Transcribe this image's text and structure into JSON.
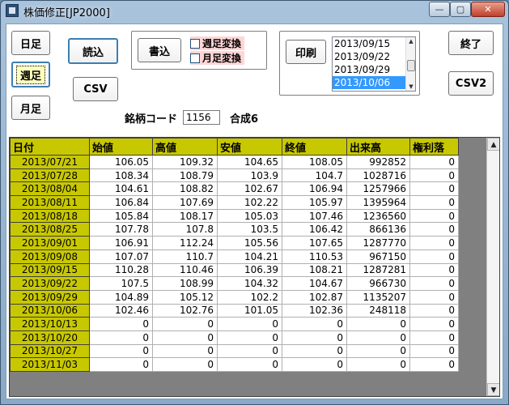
{
  "window": {
    "title": "株価修正[JP2000]",
    "min_glyph": "—",
    "max_glyph": "▢",
    "close_glyph": "✕"
  },
  "buttons": {
    "daily": "日足",
    "weekly": "週足",
    "monthly": "月足",
    "load": "読込",
    "csv": "CSV",
    "write": "書込",
    "print": "印刷",
    "exit": "終了",
    "csv2": "CSV2"
  },
  "checks": {
    "weekly_convert": "週足変換",
    "monthly_convert": "月足変換"
  },
  "date_list": [
    "2013/09/15",
    "2013/09/22",
    "2013/09/29",
    "2013/10/06"
  ],
  "date_list_selected": "2013/10/06",
  "stock": {
    "code_label": "銘柄コード",
    "code": "1156",
    "name": "合成6"
  },
  "grid": {
    "headers": [
      "日付",
      "始値",
      "高値",
      "安値",
      "終値",
      "出来高",
      "権利落"
    ],
    "rows": [
      [
        "2013/07/21",
        "106.05",
        "109.32",
        "104.65",
        "108.05",
        "992852",
        "0"
      ],
      [
        "2013/07/28",
        "108.34",
        "108.79",
        "103.9",
        "104.7",
        "1028716",
        "0"
      ],
      [
        "2013/08/04",
        "104.61",
        "108.82",
        "102.67",
        "106.94",
        "1257966",
        "0"
      ],
      [
        "2013/08/11",
        "106.84",
        "107.69",
        "102.22",
        "105.97",
        "1395964",
        "0"
      ],
      [
        "2013/08/18",
        "105.84",
        "108.17",
        "105.03",
        "107.46",
        "1236560",
        "0"
      ],
      [
        "2013/08/25",
        "107.78",
        "107.8",
        "103.5",
        "106.42",
        "866136",
        "0"
      ],
      [
        "2013/09/01",
        "106.91",
        "112.24",
        "105.56",
        "107.65",
        "1287770",
        "0"
      ],
      [
        "2013/09/08",
        "107.07",
        "110.7",
        "104.21",
        "110.53",
        "967150",
        "0"
      ],
      [
        "2013/09/15",
        "110.28",
        "110.46",
        "106.39",
        "108.21",
        "1287281",
        "0"
      ],
      [
        "2013/09/22",
        "107.5",
        "108.99",
        "104.32",
        "104.67",
        "966730",
        "0"
      ],
      [
        "2013/09/29",
        "104.89",
        "105.12",
        "102.2",
        "102.87",
        "1135207",
        "0"
      ],
      [
        "2013/10/06",
        "102.46",
        "102.76",
        "101.05",
        "102.36",
        "248118",
        "0"
      ],
      [
        "2013/10/13",
        "0",
        "0",
        "0",
        "0",
        "0",
        "0"
      ],
      [
        "2013/10/20",
        "0",
        "0",
        "0",
        "0",
        "0",
        "0"
      ],
      [
        "2013/10/27",
        "0",
        "0",
        "0",
        "0",
        "0",
        "0"
      ],
      [
        "2013/11/03",
        "0",
        "0",
        "0",
        "0",
        "0",
        "0"
      ]
    ]
  },
  "colors": {
    "header_bg": "#c8c800",
    "selection": "#3399ff",
    "check_bg": "#ffd5d5"
  }
}
